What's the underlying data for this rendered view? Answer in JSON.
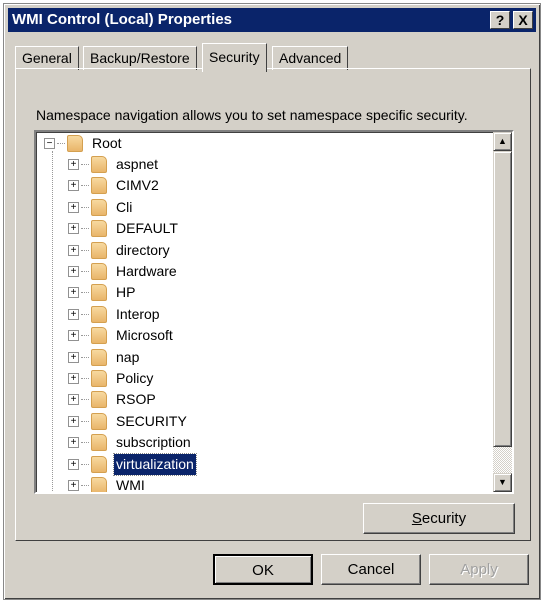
{
  "window": {
    "title": "WMI Control (Local) Properties",
    "help_label": "?",
    "close_label": "X"
  },
  "tabs": [
    {
      "label": "General"
    },
    {
      "label": "Backup/Restore"
    },
    {
      "label": "Security",
      "active": true
    },
    {
      "label": "Advanced"
    }
  ],
  "description": "Namespace navigation allows you to set namespace specific security.",
  "tree": {
    "root": "Root",
    "children": [
      "aspnet",
      "CIMV2",
      "Cli",
      "DEFAULT",
      "directory",
      "Hardware",
      "HP",
      "Interop",
      "Microsoft",
      "nap",
      "Policy",
      "RSOP",
      "SECURITY",
      "subscription",
      "virtualization",
      "WMI"
    ],
    "selected": "virtualization"
  },
  "buttons": {
    "security": "Security",
    "ok": "OK",
    "cancel": "Cancel",
    "apply": "Apply"
  },
  "colors": {
    "titlebar": "#0a246a",
    "selection": "#0a246a",
    "face": "#d4d0c8"
  }
}
